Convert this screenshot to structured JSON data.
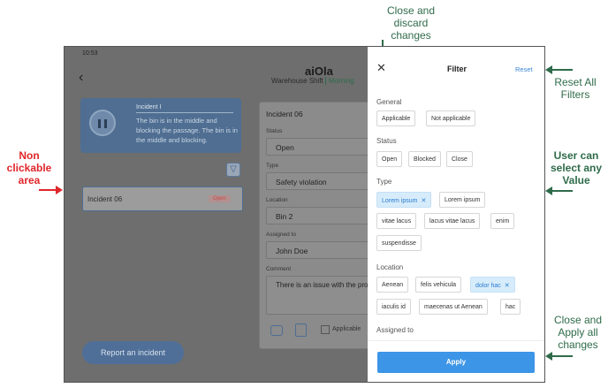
{
  "annotations": {
    "close_discard": [
      "Close and",
      "discard",
      "changes"
    ],
    "reset_all": [
      "Reset All",
      "Filters"
    ],
    "non_clickable": [
      "Non",
      "clickable",
      "area"
    ],
    "select_any": [
      "User can",
      "select any",
      "Value"
    ],
    "close_apply": [
      "Close and",
      "Apply all",
      "changes"
    ]
  },
  "status_bar": {
    "time": "10:53"
  },
  "header": {
    "logo": "aiOla",
    "shift_label": "Warehouse Shift",
    "shift_value": "Morning"
  },
  "player_card": {
    "title": "Incident I",
    "description": "The bin is in the middle and blocking the passage. The bin is in the middle and blocking."
  },
  "incident_row": {
    "label": "Incident 06",
    "badge": "Open"
  },
  "detail": {
    "title": "Incident 06",
    "fields": [
      {
        "label": "Status",
        "value": "Open"
      },
      {
        "label": "Type",
        "value": "Safety violation"
      },
      {
        "label": "Location",
        "value": "Bin 2"
      },
      {
        "label": "Assigned to",
        "value": "John Doe"
      }
    ],
    "comment_label": "Comment",
    "comment_value": "There is an issue with the pro",
    "applicable_label": "Applicable"
  },
  "report_button": "Report an incident",
  "filter": {
    "title": "Filter",
    "reset": "Reset",
    "sections": {
      "general": {
        "label": "General",
        "options": [
          "Applicable",
          "Not applicable"
        ]
      },
      "status": {
        "label": "Status",
        "options": [
          "Open",
          "Blocked",
          "Close"
        ]
      },
      "type": {
        "label": "Type",
        "options": [
          "Lorem ipsum",
          "Lorem ipsum",
          "vitae lacus",
          "lacus vitae lacus",
          "enim",
          "suspendisse"
        ]
      },
      "location": {
        "label": "Location",
        "options": [
          "Aenean",
          "felis vehicula",
          "dolor hac",
          "iaculis id",
          "maecenas ut Aenean",
          "hac"
        ]
      },
      "assigned": {
        "label": "Assigned to"
      }
    },
    "apply": "Apply"
  }
}
